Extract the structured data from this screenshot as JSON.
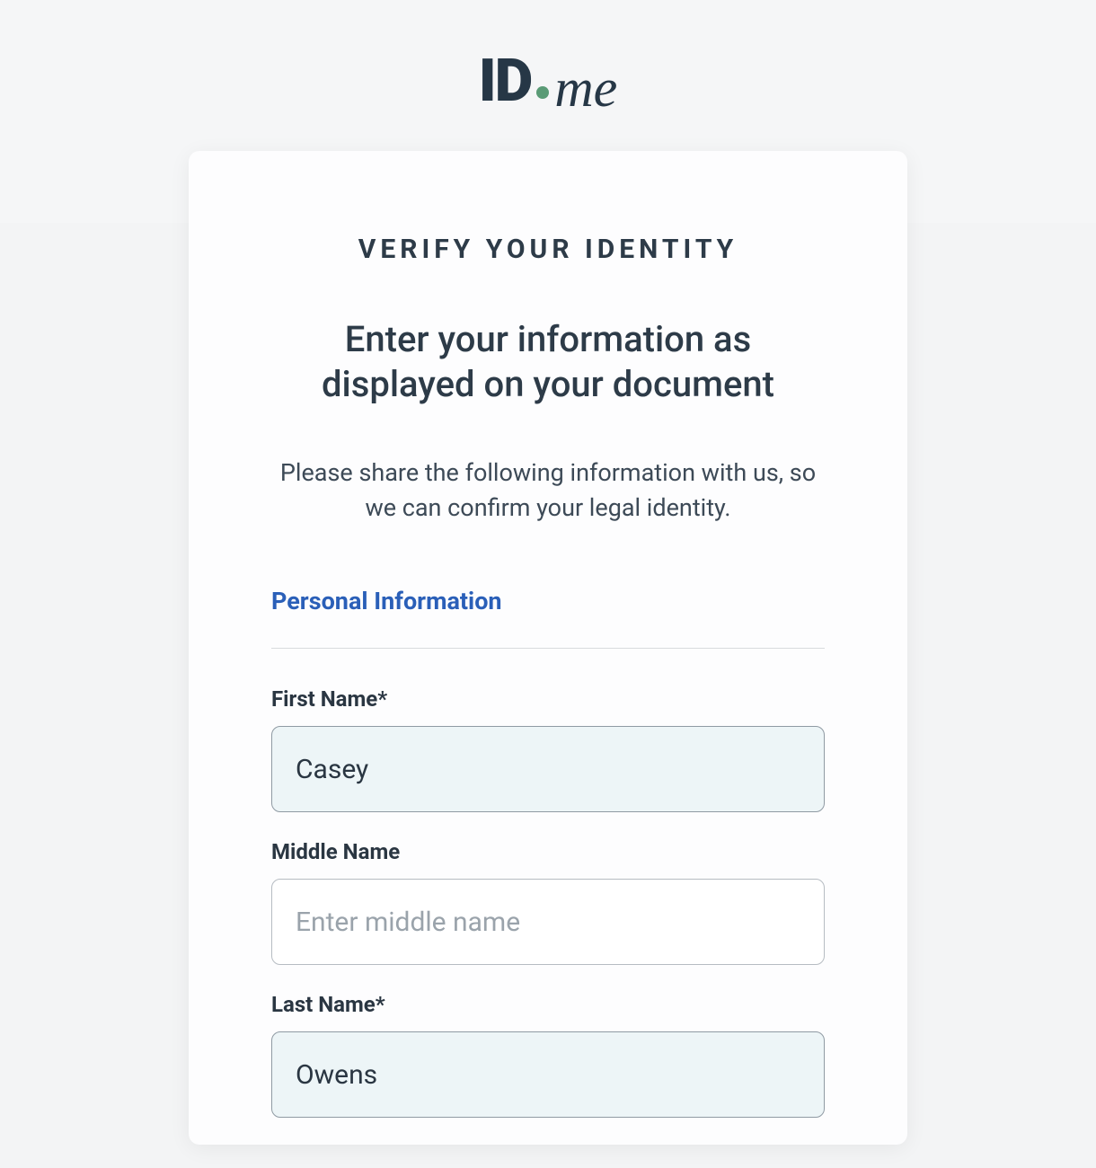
{
  "logo": {
    "id_text": "ID",
    "me_text": "me"
  },
  "page": {
    "title": "VERIFY YOUR IDENTITY",
    "subheading": "Enter your information as displayed on your document",
    "description": "Please share the following information with us, so we can confirm your legal identity."
  },
  "section": {
    "title": "Personal Information"
  },
  "fields": {
    "first_name": {
      "label": "First Name*",
      "value": "Casey"
    },
    "middle_name": {
      "label": "Middle Name",
      "placeholder": "Enter middle name",
      "value": ""
    },
    "last_name": {
      "label": "Last Name*",
      "value": "Owens"
    }
  }
}
